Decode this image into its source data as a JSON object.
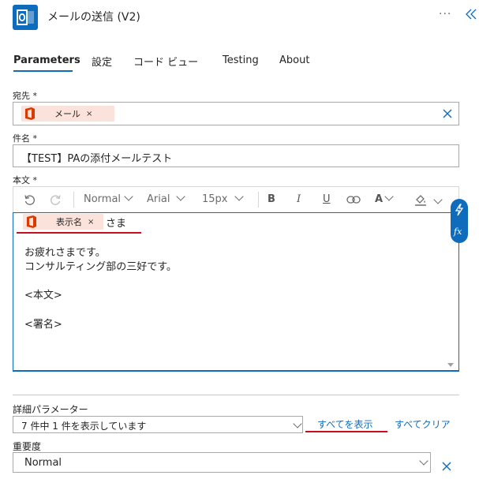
{
  "header": {
    "title": "メールの送信 (V2)",
    "more": "···",
    "app_icon": "outlook-icon",
    "collapse_icon": "double-chevron-left-icon"
  },
  "tabs": [
    {
      "label": "Parameters",
      "active": true
    },
    {
      "label": "設定",
      "active": false
    },
    {
      "label": "コード ビュー",
      "active": false
    },
    {
      "label": "Testing",
      "active": false
    },
    {
      "label": "About",
      "active": false
    }
  ],
  "to_field": {
    "label": "宛先",
    "required": "*",
    "token_label": "メール",
    "token_remove": "×"
  },
  "subject_field": {
    "label": "件名",
    "required": "*",
    "value": "【TEST】PAの添付メールテスト"
  },
  "body_field": {
    "label": "本文",
    "required": "*",
    "toolbar": {
      "style": "Normal",
      "font": "Arial",
      "size": "15px",
      "bold": "B",
      "italic": "I",
      "underline": "U",
      "font_color": "A"
    },
    "token_label": "表示名",
    "token_remove": "×",
    "after_token": "さま",
    "lines": [
      "お疲れさまです。",
      "コンサルティング部の三好です。",
      "<本文>",
      "<署名>"
    ]
  },
  "advanced": {
    "label": "詳細パラメーター",
    "select_value": "7 件中 1 件を表示しています",
    "show_all": "すべてを表示",
    "clear_all": "すべてクリア"
  },
  "importance": {
    "label": "重要度",
    "value": "Normal"
  },
  "colors": {
    "accent": "#0f6cbd",
    "office": "#d83b01",
    "token_bg": "#fbe3dc",
    "annotation": "#c50f1f"
  }
}
